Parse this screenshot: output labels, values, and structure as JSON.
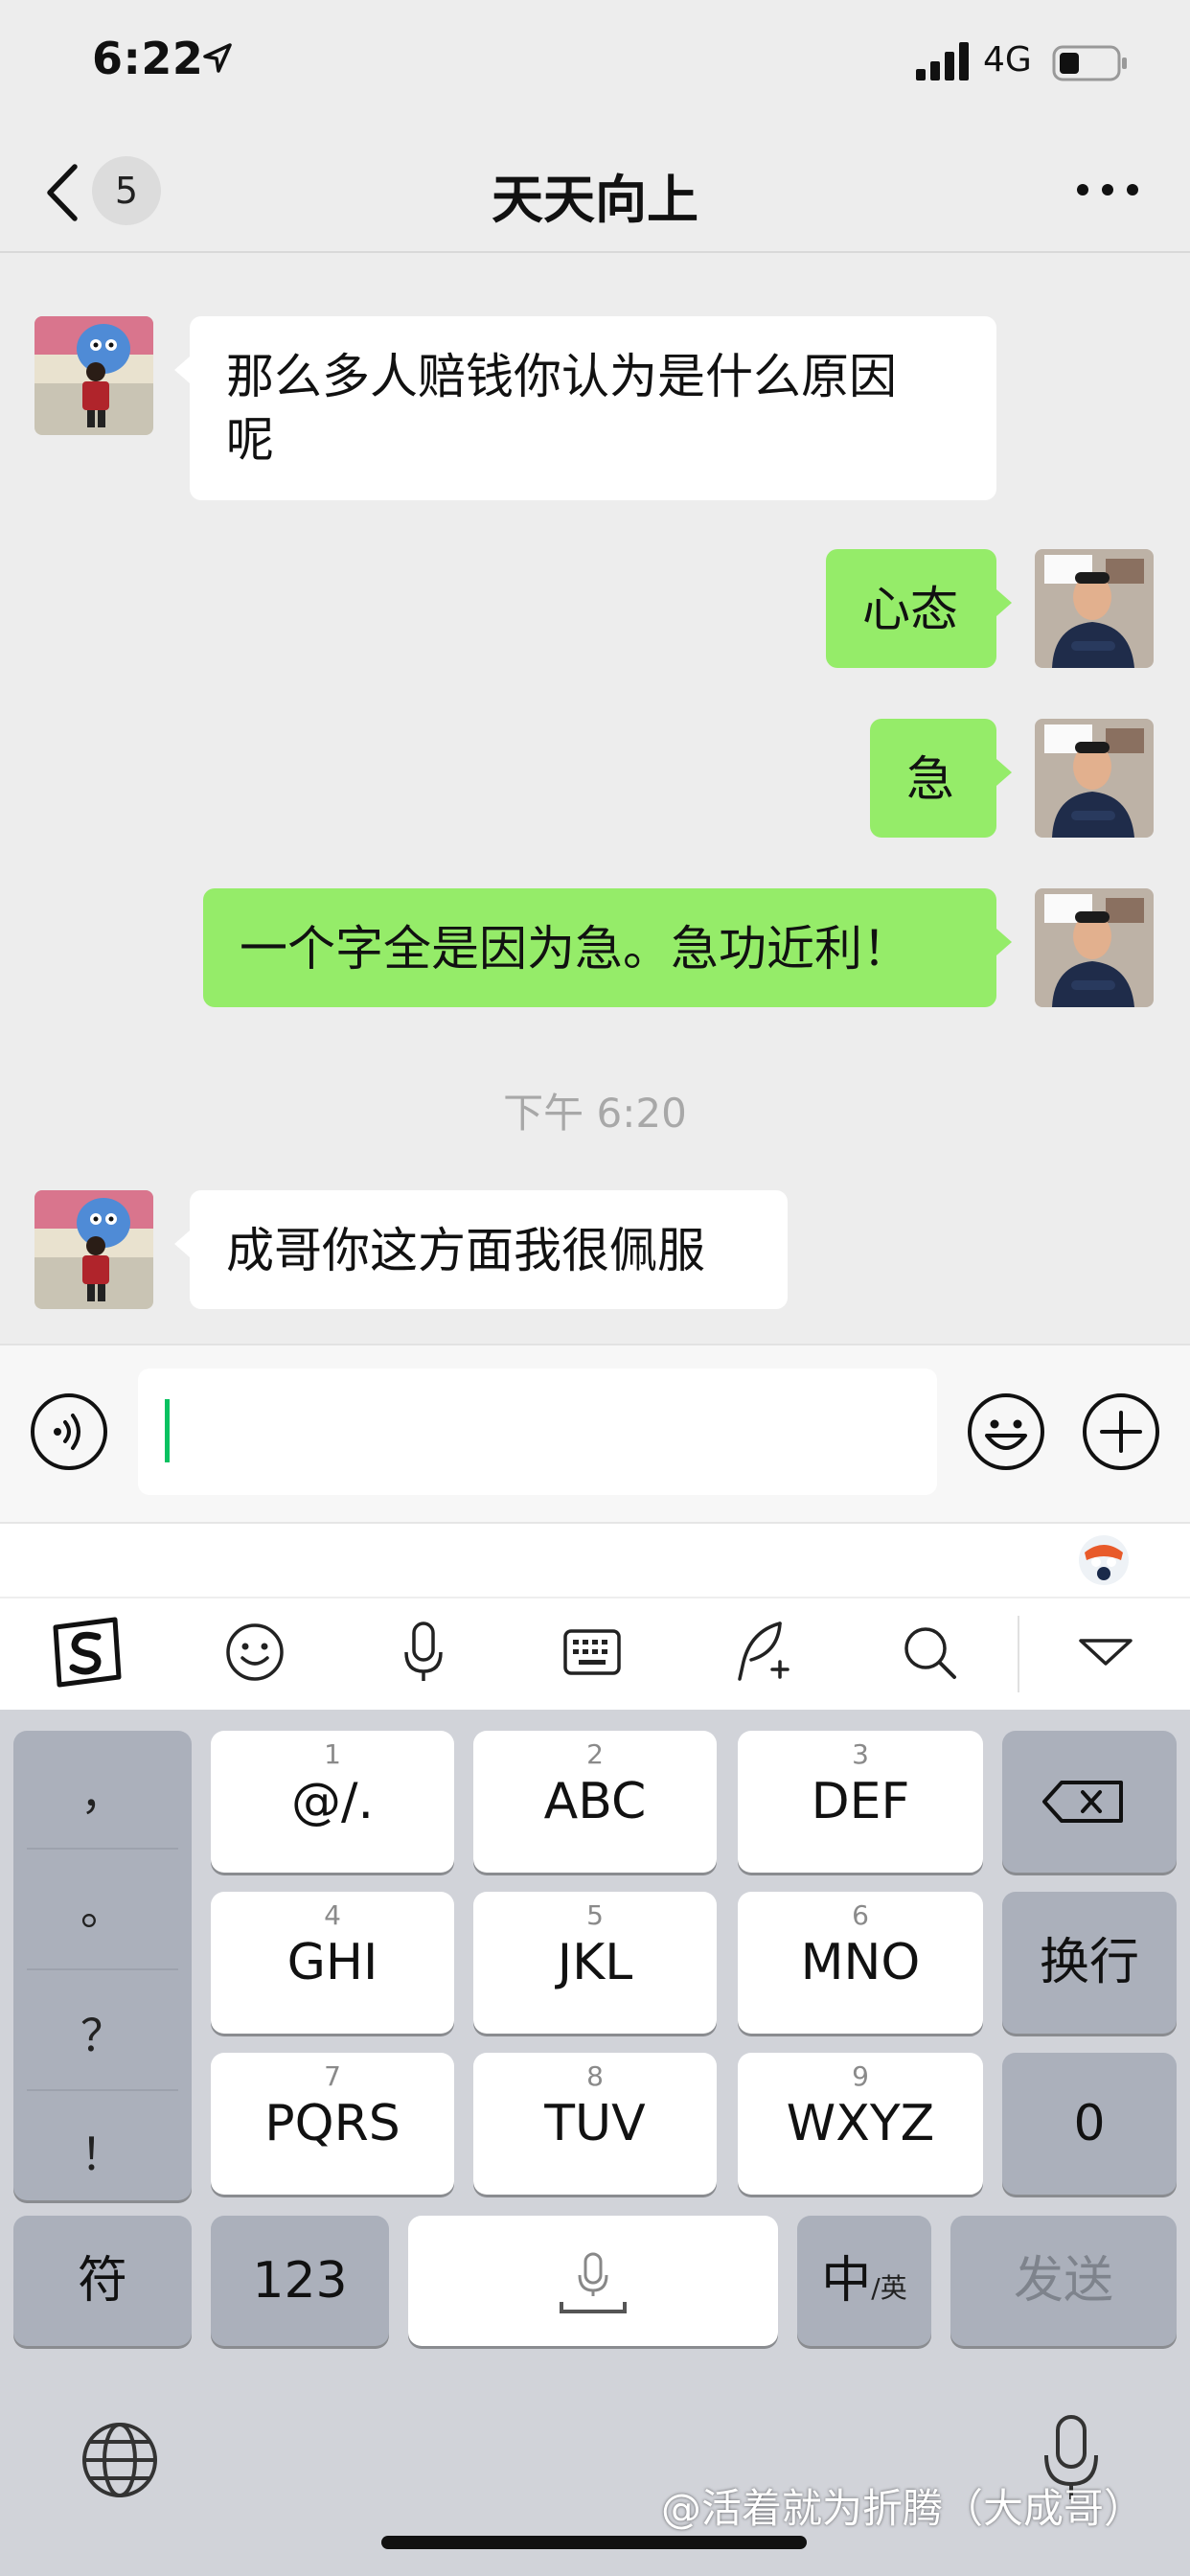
{
  "status_bar": {
    "time": "6:22",
    "network": "4G"
  },
  "header": {
    "unread_count": "5",
    "title": "天天向上"
  },
  "messages": [
    {
      "side": "left",
      "lines": [
        "那么多人赔钱你认为是什么原因",
        "呢"
      ]
    },
    {
      "side": "right",
      "text": "心态"
    },
    {
      "side": "right",
      "text": "急"
    },
    {
      "side": "right",
      "text": "一个字全是因为急。急功近利！"
    },
    {
      "side": "left",
      "text": "成哥你这方面我很佩服"
    }
  ],
  "timestamp": "下午 6:20",
  "keyboard": {
    "punctuation": [
      "，",
      "。",
      "？",
      "！"
    ],
    "keys": [
      {
        "num": "1",
        "letters": "@/."
      },
      {
        "num": "2",
        "letters": "ABC"
      },
      {
        "num": "3",
        "letters": "DEF"
      },
      {
        "num": "4",
        "letters": "GHI"
      },
      {
        "num": "5",
        "letters": "JKL"
      },
      {
        "num": "6",
        "letters": "MNO"
      },
      {
        "num": "7",
        "letters": "PQRS"
      },
      {
        "num": "8",
        "letters": "TUV"
      },
      {
        "num": "9",
        "letters": "WXYZ"
      }
    ],
    "newline": "换行",
    "zero": "0",
    "symbols": "符",
    "numbers": "123",
    "lang_main": "中",
    "lang_sub": "/英",
    "send": "发送"
  },
  "watermark": "@活着就为折腾（大成哥）",
  "colors": {
    "outgoing_bubble": "#95ec69",
    "incoming_bubble": "#ffffff",
    "caret": "#07c160",
    "background": "#ededed"
  }
}
